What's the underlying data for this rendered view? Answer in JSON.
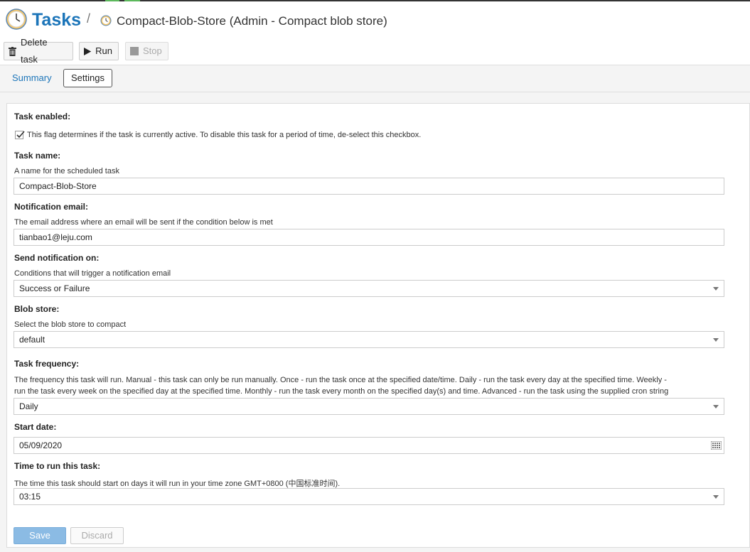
{
  "header": {
    "title": "Tasks",
    "separator": "/",
    "subtitle": "Compact-Blob-Store (Admin - Compact blob store)"
  },
  "toolbar": {
    "delete_label": "Delete task",
    "run_label": "Run",
    "stop_label": "Stop"
  },
  "tabs": {
    "summary": "Summary",
    "settings": "Settings"
  },
  "form": {
    "task_enabled": {
      "label": "Task enabled:",
      "help": "This flag determines if the task is currently active. To disable this task for a period of time, de-select this checkbox.",
      "checked": true
    },
    "task_name": {
      "label": "Task name:",
      "help": "A name for the scheduled task",
      "value": "Compact-Blob-Store"
    },
    "notification_email": {
      "label": "Notification email:",
      "help": "The email address where an email will be sent if the condition below is met",
      "value": "tianbao1@leju.com"
    },
    "send_notification": {
      "label": "Send notification on:",
      "help": "Conditions that will trigger a notification email",
      "value": "Success or Failure"
    },
    "blob_store": {
      "label": "Blob store:",
      "help": "Select the blob store to compact",
      "value": "default"
    },
    "task_frequency": {
      "label": "Task frequency:",
      "help_line1": "The frequency this task will run. Manual - this task can only be run manually. Once - run the task once at the specified date/time. Daily - run the task every day at the specified time. Weekly -",
      "help_line2": "run the task every week on the specified day at the specified time. Monthly - run the task every month on the specified day(s) and time. Advanced - run the task using the supplied cron string",
      "value": "Daily"
    },
    "start_date": {
      "label": "Start date:",
      "value": "05/09/2020"
    },
    "time_to_run": {
      "label": "Time to run this task:",
      "help": "The time this task should start on days it will run in your time zone GMT+0800 (中国标准时间).",
      "value": "03:15"
    }
  },
  "actions": {
    "save": "Save",
    "discard": "Discard"
  },
  "colors": {
    "accent": "#1c75b9",
    "save_button": "#8bbbe4"
  }
}
